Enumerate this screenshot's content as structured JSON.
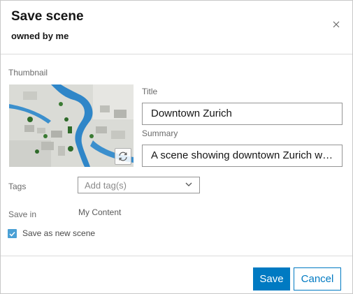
{
  "dialog": {
    "title": "Save scene",
    "subtitle": "owned by me"
  },
  "thumbnail": {
    "label": "Thumbnail",
    "refresh_icon": "refresh-icon"
  },
  "form": {
    "title_label": "Title",
    "title_value": "Downtown Zurich",
    "summary_label": "Summary",
    "summary_value": "A scene showing downtown Zurich wit...",
    "tags_label": "Tags",
    "tags_placeholder": "Add tag(s)",
    "save_in_label": "Save in",
    "save_in_value": "My Content",
    "save_as_new_label": "Save as new scene",
    "save_as_new_checked": true
  },
  "buttons": {
    "save": "Save",
    "cancel": "Cancel"
  },
  "colors": {
    "accent": "#007ac2",
    "checkbox": "#4aa0d5"
  }
}
